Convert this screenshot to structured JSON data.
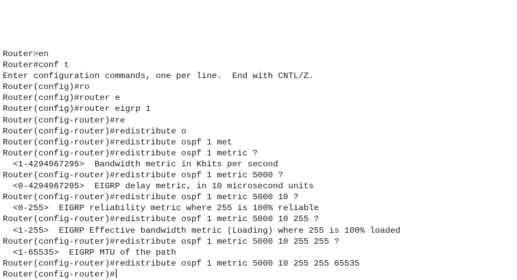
{
  "terminal": {
    "lines": [
      "Router>en",
      "Router#conf t",
      "Enter configuration commands, one per line.  End with CNTL/Z.",
      "Router(config)#ro",
      "Router(config)#router e",
      "Router(config)#router eigrp 1",
      "Router(config-router)#re",
      "Router(config-router)#redistribute o",
      "Router(config-router)#redistribute ospf 1 met",
      "Router(config-router)#redistribute ospf 1 metric ?",
      "  <1-4294967295>  Bandwidth metric in Kbits per second",
      "Router(config-router)#redistribute ospf 1 metric 5000 ?",
      "  <0-4294967295>  EIGRP delay metric, in 10 microsecond units",
      "Router(config-router)#redistribute ospf 1 metric 5000 10 ?",
      "  <0-255>  EIGRP reliability metric where 255 is 100% reliable",
      "Router(config-router)#redistribute ospf 1 metric 5000 10 255 ?",
      "  <1-255>  EIGRP Effective bandwidth metric (Loading) where 255 is 100% loaded",
      "Router(config-router)#redistribute ospf 1 metric 5000 10 255 255 ?",
      "  <1-65535>  EIGRP MTU of the path",
      "Router(config-router)#redistribute ospf 1 metric 5000 10 255 255 65535"
    ],
    "prompt": "Router(config-router)#"
  }
}
